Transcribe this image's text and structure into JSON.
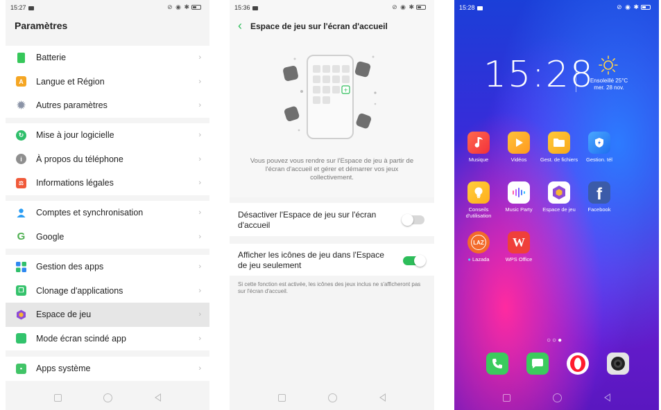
{
  "screen1": {
    "status_time": "15:27",
    "title": "Paramètres",
    "groups": [
      [
        {
          "label": "Batterie",
          "icon": "battery-icon",
          "color": "#36c75a"
        },
        {
          "label": "Langue et Région",
          "icon": "language-icon",
          "color": "#f5a623",
          "glyph": "A"
        },
        {
          "label": "Autres paramètres",
          "icon": "gear-icon",
          "color": "#8a93a6"
        }
      ],
      [
        {
          "label": "Mise à jour logicielle",
          "icon": "update-icon",
          "color": "#2fbf6b"
        },
        {
          "label": "À propos du téléphone",
          "icon": "info-icon",
          "color": "#8f8f8f"
        },
        {
          "label": "Informations légales",
          "icon": "legal-icon",
          "color": "#f05a3a"
        }
      ],
      [
        {
          "label": "Comptes et synchronisation",
          "icon": "account-icon",
          "color": "#2a9df4"
        },
        {
          "label": "Google",
          "icon": "google-icon",
          "color": "#4cae4f",
          "glyph": "G"
        }
      ],
      [
        {
          "label": "Gestion des apps",
          "icon": "apps-grid-icon",
          "color": "#2f88f0"
        },
        {
          "label": "Clonage d'applications",
          "icon": "clone-icon",
          "color": "#34c26b"
        },
        {
          "label": "Espace de jeu",
          "icon": "game-space-icon",
          "color": "#8e4bd8"
        },
        {
          "label": "Mode écran scindé app",
          "icon": "split-screen-icon",
          "color": "#32c36c"
        }
      ],
      [
        {
          "label": "Apps système",
          "icon": "android-icon",
          "color": "#41c467"
        }
      ]
    ]
  },
  "screen2": {
    "status_time": "15:36",
    "title": "Espace de jeu sur l'écran d'accueil",
    "description": "Vous pouvez vous rendre sur l'Espace de jeu à partir de l'écran d'accueil et gérer et démarrer vos jeux collectivement.",
    "option1": {
      "label": "Désactiver l'Espace de jeu sur l'écran d'accueil",
      "on": false
    },
    "option2": {
      "label": "Afficher les icônes de jeu dans l'Espace de jeu seulement",
      "on": true
    },
    "note": "Si cette fonction est activée, les icônes des jeux inclus ne s'afficheront pas sur l'écran d'accueil.",
    "accent": "#2dbd5a"
  },
  "screen3": {
    "status_time": "15:28",
    "clock": "15:28",
    "weather_line1": "Ensoleillé 25°C",
    "weather_line2": "mer. 28 nov.",
    "apps": [
      {
        "label": "Musique",
        "icon": "music-icon"
      },
      {
        "label": "Vidéos",
        "icon": "video-icon"
      },
      {
        "label": "Gest. de fichiers",
        "icon": "folder-icon"
      },
      {
        "label": "Gestion. tél",
        "icon": "phone-manager-icon"
      },
      {
        "label": "Conseils d'utilisation",
        "icon": "tips-bulb-icon"
      },
      {
        "label": "Music Party",
        "icon": "music-party-icon"
      },
      {
        "label": "Espace de jeu",
        "icon": "game-space-icon"
      },
      {
        "label": "Facebook",
        "icon": "facebook-icon"
      },
      {
        "label": "Lazada",
        "icon": "lazada-icon"
      },
      {
        "label": "WPS Office",
        "icon": "wps-office-icon"
      }
    ],
    "lazada_icon_text": "LAZ",
    "dock": [
      {
        "icon": "phone-dialer-icon"
      },
      {
        "icon": "messages-icon"
      },
      {
        "icon": "opera-browser-icon"
      },
      {
        "icon": "camera-icon"
      }
    ]
  }
}
